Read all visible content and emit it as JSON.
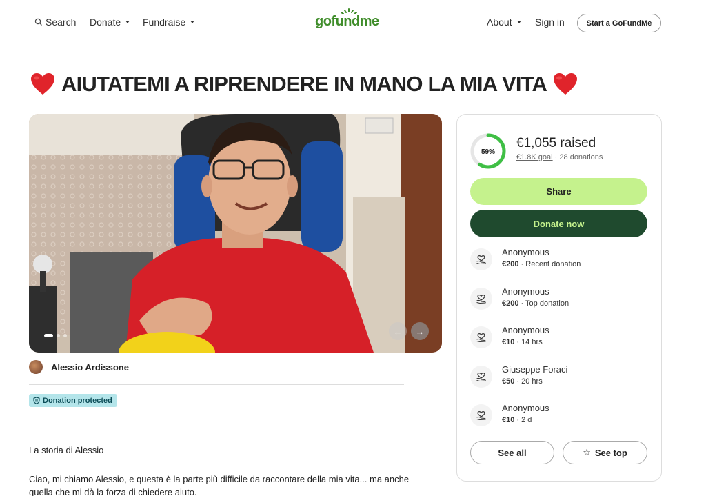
{
  "nav": {
    "search_label": "Search",
    "donate_label": "Donate",
    "fundraise_label": "Fundraise",
    "logo_text": "gofundme",
    "about_label": "About",
    "signin_label": "Sign in",
    "start_label": "Start a GoFundMe"
  },
  "campaign": {
    "title": "AIUTATEMI A RIPRENDERE IN MANO LA MIA VITA",
    "organizer": "Alessio Ardissone",
    "protected_label": "Donation protected",
    "story_title": "La storia di Alessio",
    "story_text": "Ciao, mi chiamo Alessio, e questa è la parte più difficile da raccontare della mia vita... ma anche quella che mi dà la forza di chiedere aiuto."
  },
  "sidebar": {
    "progress_percent": 59,
    "progress_label": "59%",
    "raised_text": "€1,055 raised",
    "goal_text": "€1.8K goal",
    "donations_text": "28 donations",
    "share_label": "Share",
    "donate_now_label": "Donate now",
    "see_all_label": "See all",
    "see_top_label": "See top",
    "donations": [
      {
        "name": "Anonymous",
        "amount": "€200",
        "info": " · Recent donation"
      },
      {
        "name": "Anonymous",
        "amount": "€200",
        "info": " · Top donation"
      },
      {
        "name": "Anonymous",
        "amount": "€10",
        "info": " · 14 hrs"
      },
      {
        "name": "Giuseppe Foraci",
        "amount": "€50",
        "info": " · 20 hrs"
      },
      {
        "name": "Anonymous",
        "amount": "€10",
        "info": " · 2 d"
      }
    ]
  },
  "colors": {
    "brand_green": "#3f8d2a",
    "share_bg": "#c5f28d",
    "donate_bg": "#1f4a2e",
    "badge_bg": "#b4e5ea"
  }
}
